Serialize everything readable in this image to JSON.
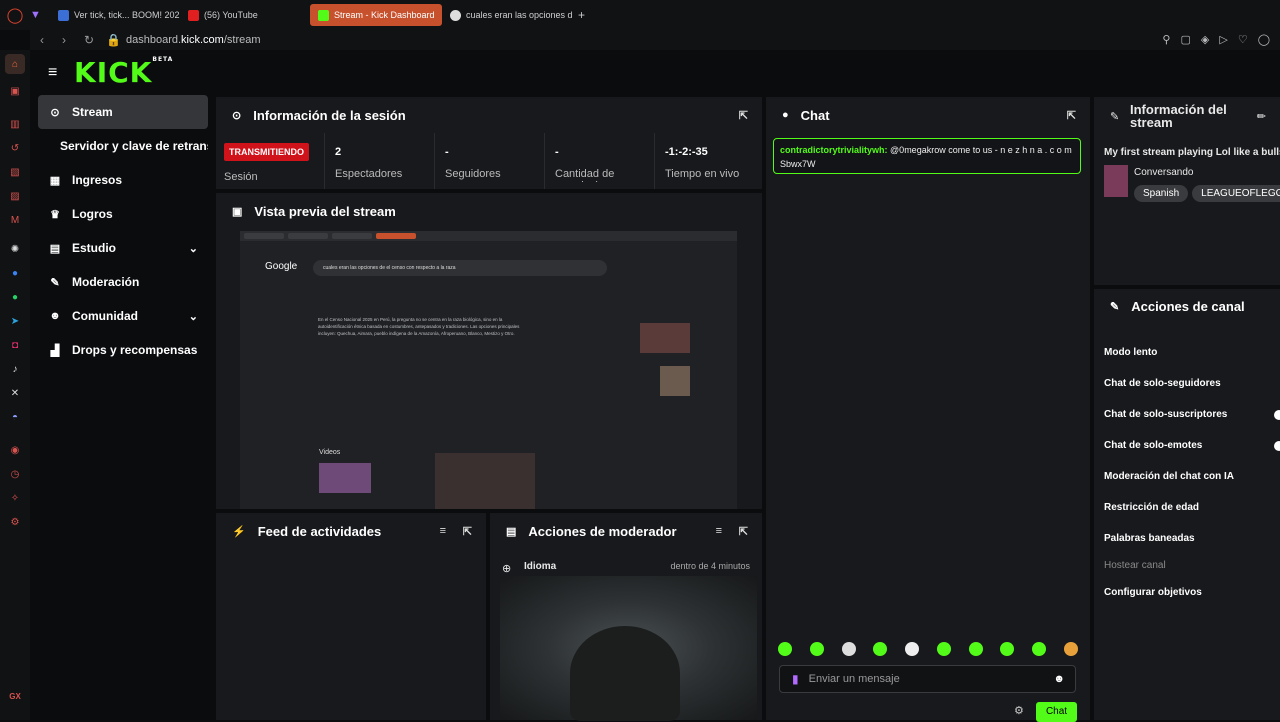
{
  "browser": {
    "tabs": [
      {
        "label": "Ver tick, tick... BOOM! 202",
        "color": "#3b6fd6"
      },
      {
        "label": "(56) YouTube",
        "color": "#e02020"
      },
      {
        "label": "Stream - Kick Dashboard",
        "color": "#53fc18",
        "active": true
      },
      {
        "label": "cuales eran las opciones d",
        "color": "#dddddd"
      }
    ],
    "new_tab": "+",
    "url_prefix": "dashboard.",
    "url_domain": "kick.com",
    "url_path": "/stream"
  },
  "app": {
    "logo": "KICK",
    "logo_beta": "BETA",
    "accent": "#53fc18"
  },
  "nav": {
    "items": [
      {
        "label": "Stream",
        "icon": "stream-icon",
        "glyph": "⊙"
      },
      {
        "label": "Servidor y clave de retransm",
        "icon": "",
        "glyph": ""
      },
      {
        "label": "Ingresos",
        "icon": "revenue-icon",
        "glyph": "▦"
      },
      {
        "label": "Logros",
        "icon": "trophy-icon",
        "glyph": "🏆"
      },
      {
        "label": "Estudio",
        "icon": "studio-icon",
        "glyph": "▤",
        "chev": "⌄"
      },
      {
        "label": "Moderación",
        "icon": "wrench-icon",
        "glyph": "⚒"
      },
      {
        "label": "Comunidad",
        "icon": "community-icon",
        "glyph": "👥",
        "chev": "⌄"
      },
      {
        "label": "Drops y recompensas",
        "icon": "drops-icon",
        "glyph": "▟"
      }
    ]
  },
  "session": {
    "title": "Información de la sesión",
    "status_badge": "TRANSMITIENDO",
    "status_label": "Sesión",
    "stats": [
      {
        "value": "2",
        "label": "Espectadores"
      },
      {
        "value": "-",
        "label": "Seguidores"
      },
      {
        "value": "-",
        "label": "Cantidad de suscripciones"
      },
      {
        "value": "-1:-2:-35",
        "label": "Tiempo en vivo"
      }
    ]
  },
  "preview": {
    "title": "Vista previa del stream",
    "google_logo": "Google",
    "search_query": "cuales eran las opciones de el censo con respecto a la raza",
    "text_block": "En el Censo Nacional 2025 en Perú, la pregunta no se centra en la raza biológica, sino en la autoidentificación étnica basada en costumbres, antepasados y tradiciones. Las opciones principales incluyen: Quechua, Aimara, pueblo indígena de la Amazonía, Afroperuano, Blanco, Mestizo y Otro.",
    "videos_label": "Videos"
  },
  "activity": {
    "title": "Feed de actividades"
  },
  "modactions": {
    "title": "Acciones de moderador",
    "item_label": "Idioma",
    "item_time": "dentro de 4 minutos"
  },
  "chat": {
    "title": "Chat",
    "messages": [
      {
        "user": "contradictorytrivialitywh:",
        "text": "@0megakrow come to us - n e z h n a . c o m Sbwx7W"
      }
    ],
    "placeholder": "Enviar un mensaje",
    "send_label": "Chat"
  },
  "stream_info": {
    "title": "Información del stream",
    "stream_title": "My first stream playing Lol like a bullsh",
    "category": "Conversando",
    "tags": [
      "Spanish",
      "LEAGUEOFLEGGEND"
    ]
  },
  "channel_actions": {
    "title": "Acciones de canal",
    "items": [
      {
        "label": "Modo lento"
      },
      {
        "label": "Chat de solo-seguidores"
      },
      {
        "label": "Chat de solo-suscriptores",
        "toggle": true
      },
      {
        "label": "Chat de solo-emotes",
        "toggle": true
      },
      {
        "label": "Moderación del chat con IA"
      },
      {
        "label": "Restricción de edad"
      },
      {
        "label": "Palabras baneadas"
      },
      {
        "label": "Hostear canal",
        "disabled": true
      },
      {
        "label": "Configurar objetivos"
      }
    ]
  }
}
